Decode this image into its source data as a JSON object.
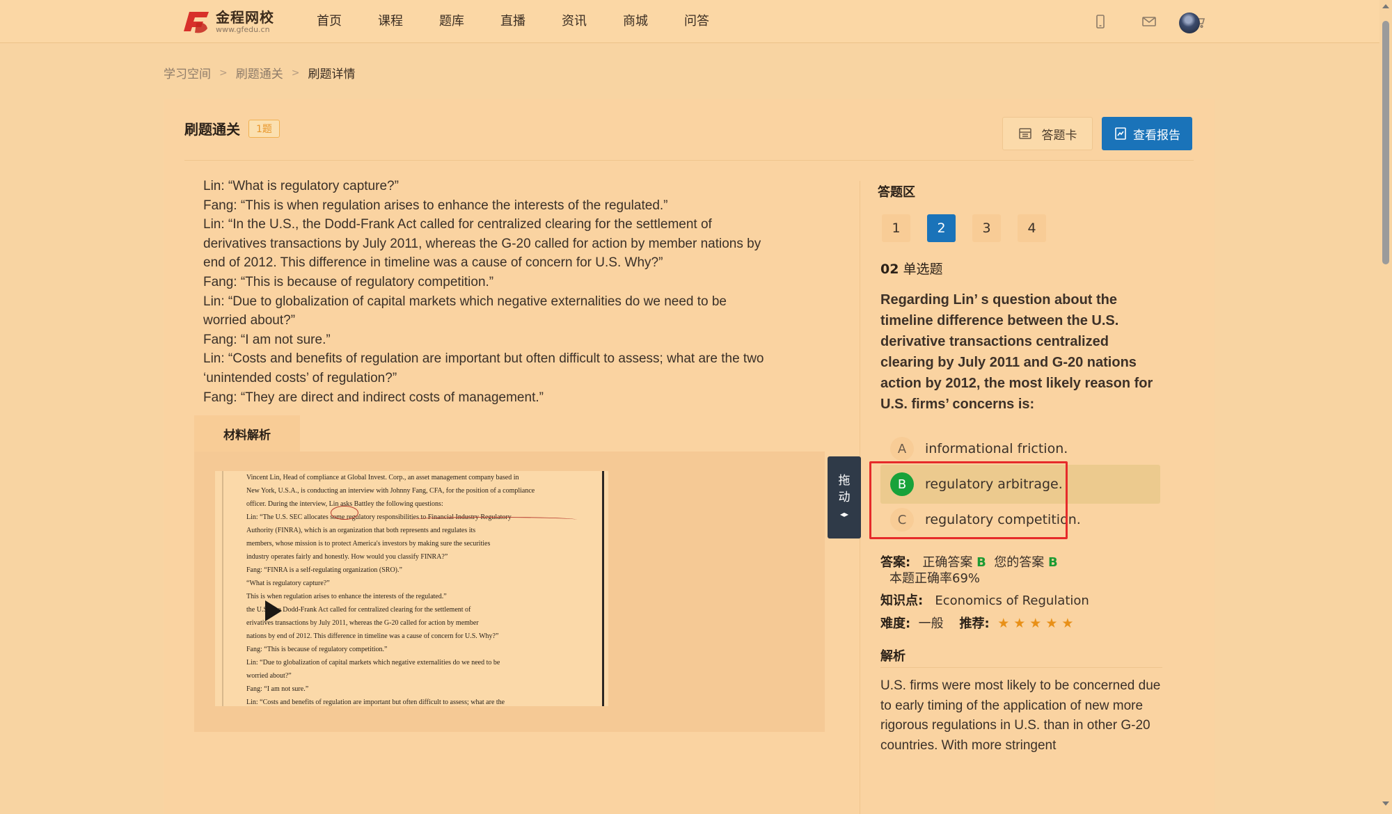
{
  "logo": {
    "title": "金程网校",
    "url": "www.gfedu.cn"
  },
  "nav": [
    "首页",
    "课程",
    "题库",
    "直播",
    "资讯",
    "商城",
    "问答"
  ],
  "breadcrumb": [
    "学习空间",
    "刷题通关",
    "刷题详情"
  ],
  "header": {
    "title": "刷题通关",
    "badge": "1题",
    "card_btn": "答题卡",
    "report_btn": "查看报告"
  },
  "passage": [
    "Lin: “What is regulatory capture?”",
    "Fang: “This is when regulation arises to enhance the interests of the regulated.”",
    "Lin: “In the U.S., the Dodd-Frank Act called for centralized clearing for the settlement of",
    "derivatives transactions by July 2011, whereas the G-20 called for action by member nations by",
    "end of 2012. This difference in timeline was a cause of concern for U.S. Why?”",
    "Fang: “This is because of regulatory competition.”",
    "Lin: “Due to globalization of capital markets which negative externalities do we need to be",
    "worried about?”",
    "Fang: “I am not sure.”",
    "Lin: “Costs and benefits of regulation are important but often difficult to assess; what are the two",
    "  ‘unintended costs’  of regulation?”",
    "Fang: “They are direct and indirect costs of management.”"
  ],
  "material": {
    "tab": "材料解析",
    "doc_lines": [
      "Vincent Lin, Head of compliance at Global Invest. Corp., an asset management company based in",
      "New York, U.S.A., is conducting an interview with Johnny Fang, CFA, for the position of a compliance",
      "officer. During the interview, Lin asks Battley the following questions:",
      "Lin:        “The U.S. SEC allocates some regulatory responsibilities to Financial Industry Regulatory",
      "              Authority (FINRA), which is an organization that both represents and regulates its",
      "              members, whose mission is to protect America's investors by making sure the securities",
      "              industry operates fairly and honestly. How would you classify FINRA?”",
      "Fang:      “FINRA is a self-regulating organization (SRO).”",
      "              “What is regulatory capture?”",
      "               This is when regulation arises to enhance the interests of the regulated.”",
      "                 the U.S., the Dodd-Frank Act called for centralized clearing for the settlement of",
      "               erivatives transactions by July 2011, whereas the G-20 called for action by member",
      "              nations by end of 2012. This difference in timeline was a cause of concern for U.S. Why?”",
      "Fang:      “This is because of regulatory competition.”",
      "Lin:        “Due to globalization of capital markets which negative externalities do we need to be",
      "              worried about?”",
      "Fang:      “I am not sure.”",
      "Lin:        “Costs and benefits of regulation are important but often difficult to assess; what are the"
    ]
  },
  "drag": {
    "line1": "拖",
    "line2": "动",
    "icon": "◆"
  },
  "answer_area": {
    "title": "答题区",
    "numbers": [
      "1",
      "2",
      "3",
      "4"
    ],
    "active_number": "2",
    "qtype_num": "02",
    "qtype_label": "单选题",
    "question": "Regarding Lin’ s question about the timeline difference between the U.S. derivative transactions centralized clearing by July 2011 and G-20 nations action by 2012, the most likely reason for U.S. firms’  concerns is:",
    "options": [
      {
        "letter": "A",
        "text": "informational friction."
      },
      {
        "letter": "B",
        "text": "regulatory arbitrage."
      },
      {
        "letter": "C",
        "text": "regulatory competition."
      }
    ],
    "answer_label": "答案:",
    "correct_label": "正确答案",
    "correct_value": "B",
    "yours_label": "您的答案",
    "yours_value": "B",
    "accuracy": "本题正确率69%",
    "knowledge_label": "知识点:",
    "knowledge_value": "Economics of Regulation",
    "difficulty_label": "难度:",
    "difficulty_value": "一般",
    "recommend_label": "推荐:",
    "stars": 5,
    "analysis_title": "解析",
    "analysis": "U.S. firms were most likely to be concerned due to early timing of the application of new more rigorous regulations in U.S. than in other G-20 countries. With more stringent"
  },
  "colors": {
    "accent": "#1a73b9",
    "correct": "#1b9a33",
    "highlight": "#e62a2a",
    "star": "#e89018"
  }
}
